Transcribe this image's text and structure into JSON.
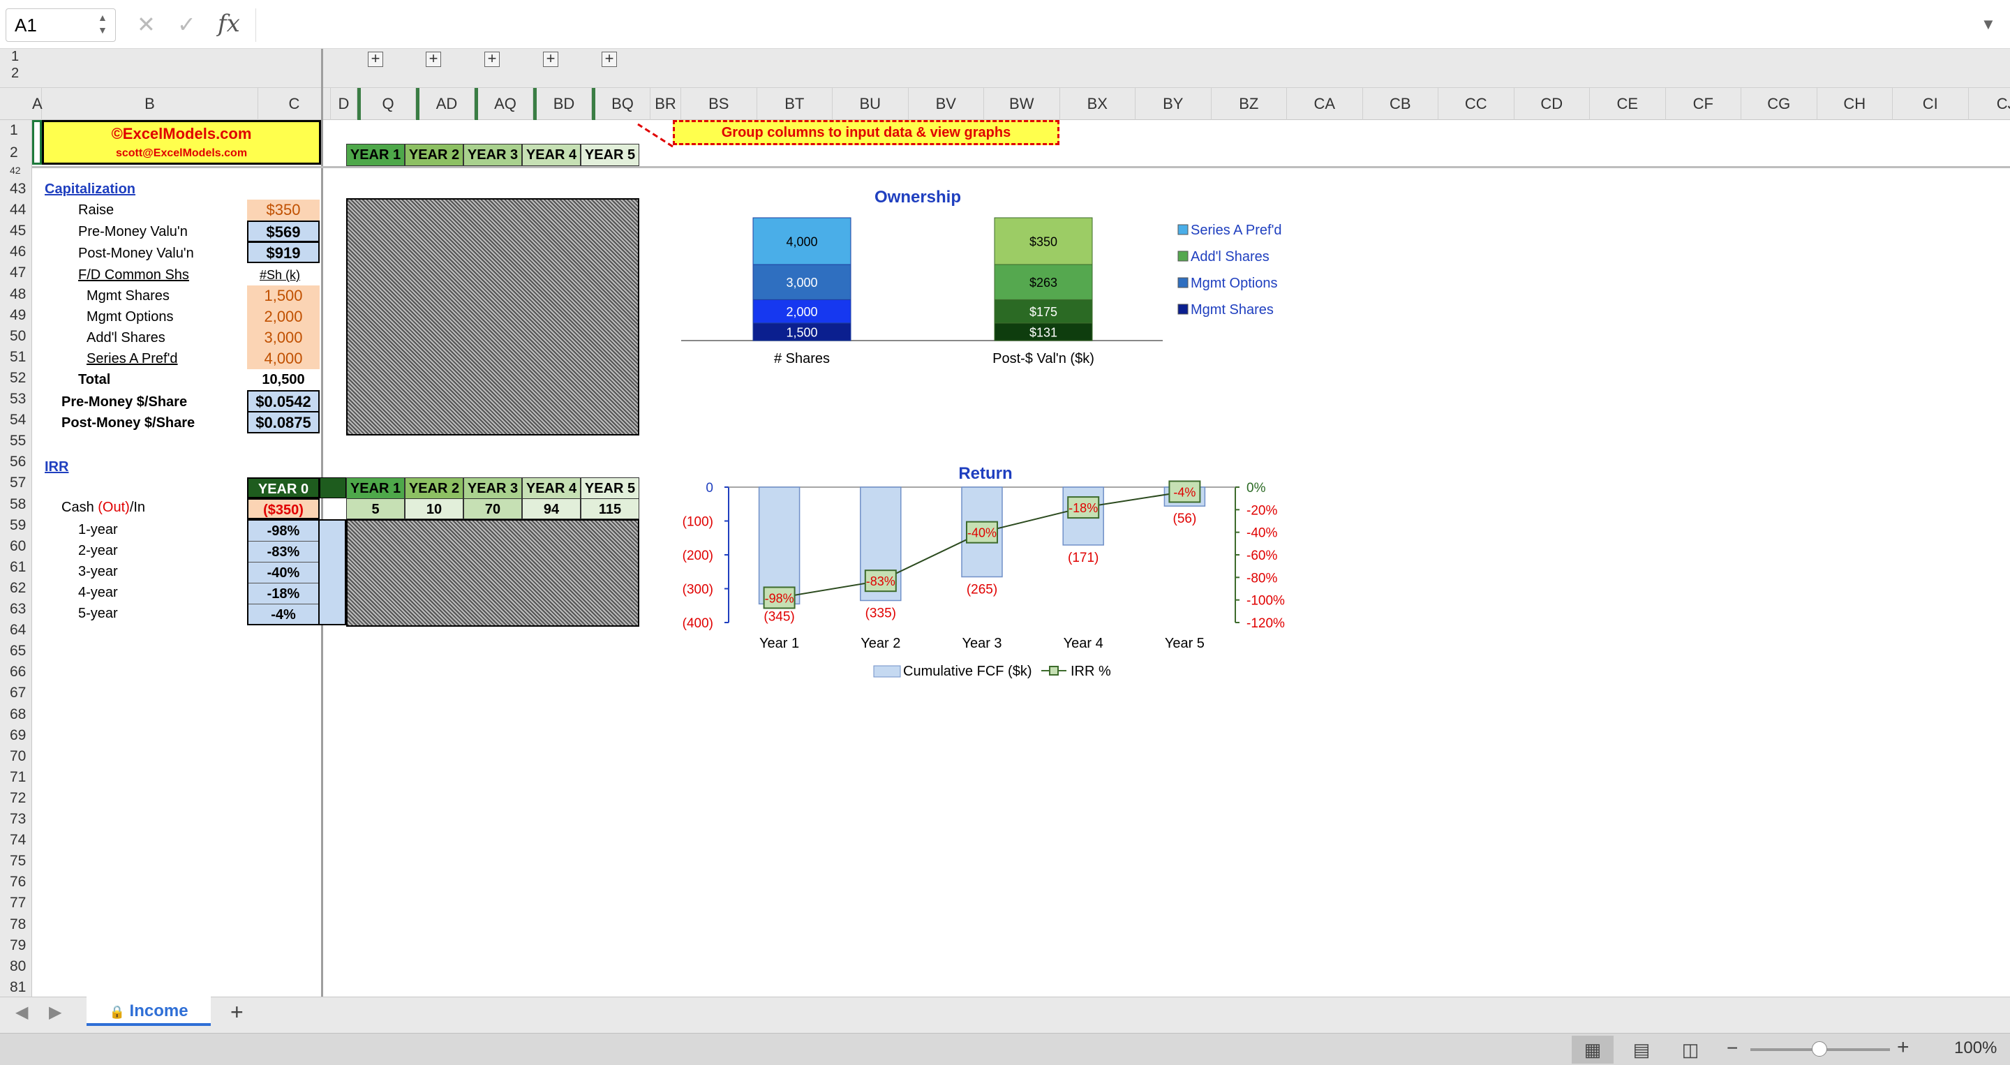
{
  "formula_bar": {
    "name_box": "A1",
    "fx": "fx",
    "formula": ""
  },
  "outline": {
    "levels": [
      "1",
      "2"
    ]
  },
  "columns": [
    "A",
    "B",
    "C",
    "D",
    "Q",
    "AD",
    "AQ",
    "BD",
    "BQ",
    "BR",
    "BS",
    "BT",
    "BU",
    "BV",
    "BW",
    "BX",
    "BY",
    "BZ",
    "CA",
    "CB",
    "CC",
    "CD",
    "CE",
    "CF",
    "CG",
    "CH",
    "CI",
    "CJ"
  ],
  "rows": [
    "1",
    "2",
    "42",
    "43",
    "44",
    "45",
    "46",
    "47",
    "48",
    "49",
    "50",
    "51",
    "52",
    "53",
    "54",
    "55",
    "56",
    "57",
    "58",
    "59",
    "60",
    "61",
    "62",
    "63",
    "64",
    "65",
    "66",
    "67",
    "68",
    "69",
    "70",
    "71",
    "72",
    "73",
    "74",
    "75",
    "76",
    "77",
    "78",
    "79",
    "80",
    "81"
  ],
  "brand": {
    "site": "©ExcelModels.com",
    "email": "scott@ExcelModels.com"
  },
  "callout": "Group columns to input data & view graphs",
  "year_headers": [
    "YEAR 1",
    "YEAR 2",
    "YEAR 3",
    "YEAR 4",
    "YEAR 5"
  ],
  "capitalization": {
    "title": "Capitalization",
    "raise_label": "Raise",
    "raise_value": "$350",
    "pre_label": "Pre-Money Valu'n",
    "pre_value": "$569",
    "post_label": "Post-Money Valu'n",
    "post_value": "$919",
    "fd_label": "F/D Common Shs",
    "fd_unit": "#Sh (k)",
    "mgmt_shares_label": "Mgmt Shares",
    "mgmt_shares": "1,500",
    "mgmt_options_label": "Mgmt Options",
    "mgmt_options": "2,000",
    "addl_label": "Add'l Shares",
    "addl": "3,000",
    "seriesA_label": "Series A Pref'd",
    "seriesA": "4,000",
    "total_label": "Total",
    "total": "10,500",
    "pre_share_label": "Pre-Money $/Share",
    "pre_share": "$0.0542",
    "post_share_label": "Post-Money $/Share",
    "post_share": "$0.0875"
  },
  "irr": {
    "title": "IRR",
    "year0": "YEAR 0",
    "cash_label_pre": "Cash ",
    "cash_label_out": "(Out)",
    "cash_label_post": "/In",
    "cash0": "($350)",
    "cash": [
      "5",
      "10",
      "70",
      "94",
      "115"
    ],
    "rows": [
      {
        "label": "1-year",
        "value": "-98%"
      },
      {
        "label": "2-year",
        "value": "-83%"
      },
      {
        "label": "3-year",
        "value": "-40%"
      },
      {
        "label": "4-year",
        "value": "-18%"
      },
      {
        "label": "5-year",
        "value": "-4%"
      }
    ]
  },
  "chart_data": [
    {
      "type": "bar",
      "stacked": true,
      "title": "Ownership",
      "categories": [
        "# Shares",
        "Post-$ Val'n ($k)"
      ],
      "series": [
        {
          "name": "Mgmt Shares",
          "values": [
            1500,
            131
          ],
          "labels": [
            "1,500",
            "$131"
          ],
          "colors": [
            "#0b1f8f",
            "#0e3d0e"
          ]
        },
        {
          "name": "Mgmt Options",
          "values": [
            2000,
            175
          ],
          "labels": [
            "2,000",
            "$175"
          ],
          "colors": [
            "#1638f0",
            "#2b6a24"
          ]
        },
        {
          "name": "Add'l Shares",
          "values": [
            3000,
            263
          ],
          "labels": [
            "3,000",
            "$263"
          ],
          "colors": [
            "#2f6fc0",
            "#55a84f"
          ]
        },
        {
          "name": "Series A Pref'd",
          "values": [
            4000,
            350
          ],
          "labels": [
            "4,000",
            "$350"
          ],
          "colors": [
            "#4aaee8",
            "#9ccc65"
          ]
        }
      ],
      "legend_colors": [
        "#4aaee8",
        "#55a84f",
        "#2f6fc0",
        "#0b1f8f"
      ],
      "legend": "right"
    },
    {
      "type": "bar",
      "title": "Return",
      "categories": [
        "Year 1",
        "Year 2",
        "Year 3",
        "Year 4",
        "Year 5"
      ],
      "series": [
        {
          "name": "Cumulative FCF ($k)",
          "type": "bar",
          "axis": "left",
          "values": [
            -345,
            -335,
            -265,
            -171,
            -56
          ],
          "labels": [
            "(345)",
            "(335)",
            "(265)",
            "(171)",
            "(56)"
          ]
        },
        {
          "name": "IRR %",
          "type": "line",
          "axis": "right",
          "values": [
            -98,
            -83,
            -40,
            -18,
            -4
          ],
          "labels": [
            "-98%",
            "-83%",
            "-40%",
            "-18%",
            "-4%"
          ]
        }
      ],
      "ylim": [
        -400,
        0
      ],
      "y_ticks": [
        "0",
        "(100)",
        "(200)",
        "(300)",
        "(400)"
      ],
      "y2lim": [
        -120,
        0
      ],
      "y2_ticks": [
        "0%",
        "-20%",
        "-40%",
        "-60%",
        "-80%",
        "-100%",
        "-120%"
      ],
      "legend": "bottom"
    }
  ],
  "sheet_tabs": {
    "active": "Income",
    "lock_icon": "🔒",
    "add": "+"
  },
  "statusbar": {
    "zoom": "100%",
    "minus": "−",
    "plus": "+"
  }
}
